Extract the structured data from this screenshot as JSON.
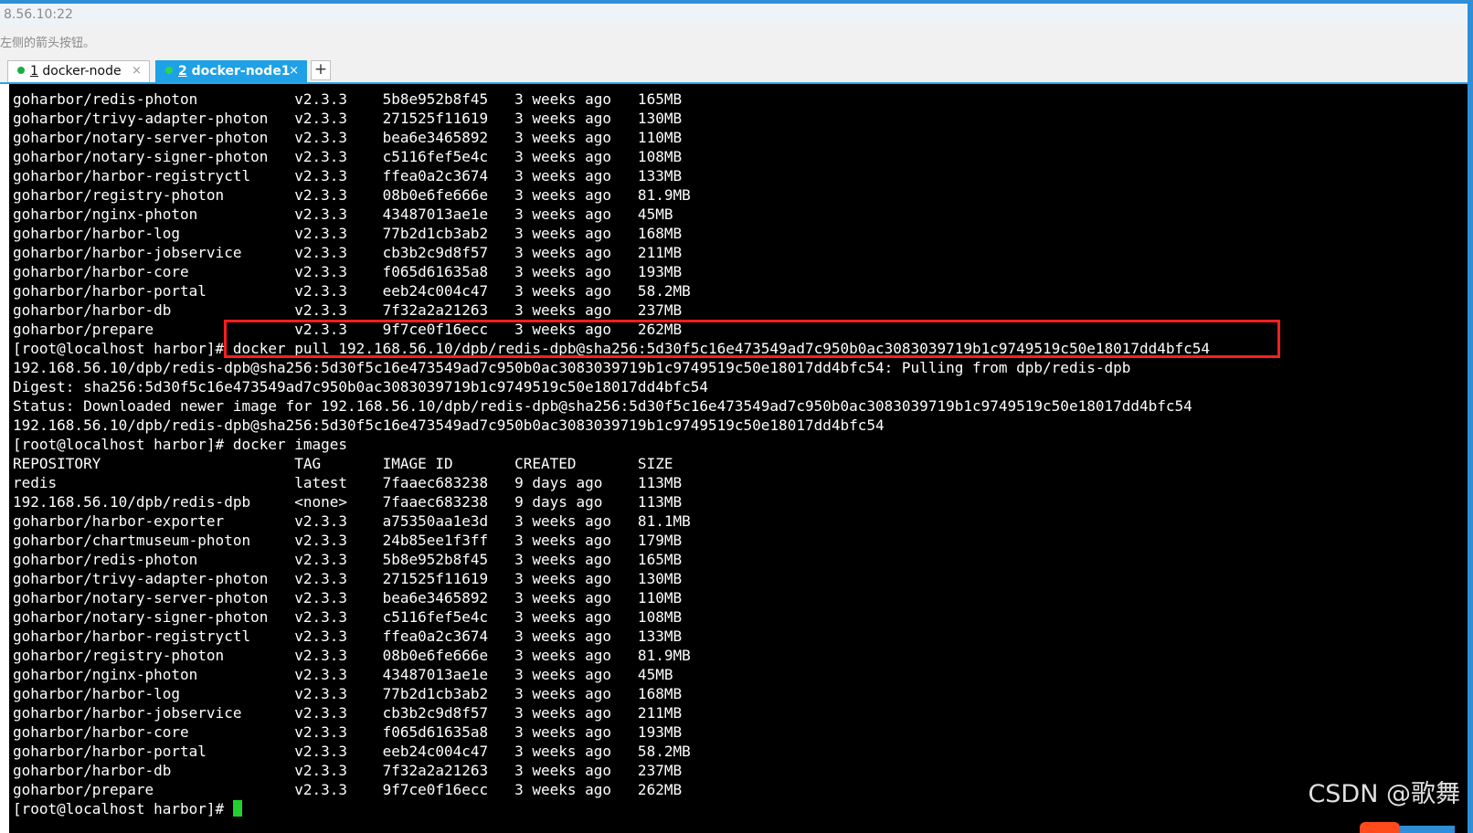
{
  "window": {
    "title_partial": "8.56.10:22",
    "hint_text": "左侧的箭头按钮。"
  },
  "tabs": [
    {
      "number": "1",
      "label": "docker-node",
      "close": "×",
      "active": false
    },
    {
      "number": "2",
      "label": "docker-node1",
      "close": "×",
      "active": true
    }
  ],
  "new_tab_label": "+",
  "terminal": {
    "lines": [
      "goharbor/redis-photon           v2.3.3    5b8e952b8f45   3 weeks ago   165MB",
      "goharbor/trivy-adapter-photon   v2.3.3    271525f11619   3 weeks ago   130MB",
      "goharbor/notary-server-photon   v2.3.3    bea6e3465892   3 weeks ago   110MB",
      "goharbor/notary-signer-photon   v2.3.3    c5116fef5e4c   3 weeks ago   108MB",
      "goharbor/harbor-registryctl     v2.3.3    ffea0a2c3674   3 weeks ago   133MB",
      "goharbor/registry-photon        v2.3.3    08b0e6fe666e   3 weeks ago   81.9MB",
      "goharbor/nginx-photon           v2.3.3    43487013ae1e   3 weeks ago   45MB",
      "goharbor/harbor-log             v2.3.3    77b2d1cb3ab2   3 weeks ago   168MB",
      "goharbor/harbor-jobservice      v2.3.3    cb3b2c9d8f57   3 weeks ago   211MB",
      "goharbor/harbor-core            v2.3.3    f065d61635a8   3 weeks ago   193MB",
      "goharbor/harbor-portal          v2.3.3    eeb24c004c47   3 weeks ago   58.2MB",
      "goharbor/harbor-db              v2.3.3    7f32a2a21263   3 weeks ago   237MB",
      "goharbor/prepare                v2.3.3    9f7ce0f16ecc   3 weeks ago   262MB",
      "[root@localhost harbor]# docker pull 192.168.56.10/dpb/redis-dpb@sha256:5d30f5c16e473549ad7c950b0ac3083039719b1c9749519c50e18017dd4bfc54",
      "192.168.56.10/dpb/redis-dpb@sha256:5d30f5c16e473549ad7c950b0ac3083039719b1c9749519c50e18017dd4bfc54: Pulling from dpb/redis-dpb",
      "Digest: sha256:5d30f5c16e473549ad7c950b0ac3083039719b1c9749519c50e18017dd4bfc54",
      "Status: Downloaded newer image for 192.168.56.10/dpb/redis-dpb@sha256:5d30f5c16e473549ad7c950b0ac3083039719b1c9749519c50e18017dd4bfc54",
      "192.168.56.10/dpb/redis-dpb@sha256:5d30f5c16e473549ad7c950b0ac3083039719b1c9749519c50e18017dd4bfc54",
      "[root@localhost harbor]# docker images",
      "REPOSITORY                      TAG       IMAGE ID       CREATED       SIZE",
      "redis                           latest    7faaec683238   9 days ago    113MB",
      "192.168.56.10/dpb/redis-dpb     <none>    7faaec683238   9 days ago    113MB",
      "goharbor/harbor-exporter        v2.3.3    a75350aa1e3d   3 weeks ago   81.1MB",
      "goharbor/chartmuseum-photon     v2.3.3    24b85ee1f3ff   3 weeks ago   179MB",
      "goharbor/redis-photon           v2.3.3    5b8e952b8f45   3 weeks ago   165MB",
      "goharbor/trivy-adapter-photon   v2.3.3    271525f11619   3 weeks ago   130MB",
      "goharbor/notary-server-photon   v2.3.3    bea6e3465892   3 weeks ago   110MB",
      "goharbor/notary-signer-photon   v2.3.3    c5116fef5e4c   3 weeks ago   108MB",
      "goharbor/harbor-registryctl     v2.3.3    ffea0a2c3674   3 weeks ago   133MB",
      "goharbor/registry-photon        v2.3.3    08b0e6fe666e   3 weeks ago   81.9MB",
      "goharbor/nginx-photon           v2.3.3    43487013ae1e   3 weeks ago   45MB",
      "goharbor/harbor-log             v2.3.3    77b2d1cb3ab2   3 weeks ago   168MB",
      "goharbor/harbor-jobservice      v2.3.3    cb3b2c9d8f57   3 weeks ago   211MB",
      "goharbor/harbor-core            v2.3.3    f065d61635a8   3 weeks ago   193MB",
      "goharbor/harbor-portal          v2.3.3    eeb24c004c47   3 weeks ago   58.2MB",
      "goharbor/harbor-db              v2.3.3    7f32a2a21263   3 weeks ago   237MB",
      "goharbor/prepare                v2.3.3    9f7ce0f16ecc   3 weeks ago   262MB"
    ],
    "prompt": "[root@localhost harbor]# ",
    "cursor_color": "#22d12e",
    "highlight_color": "#ff1e1e"
  },
  "watermark": "CSDN @歌舞"
}
